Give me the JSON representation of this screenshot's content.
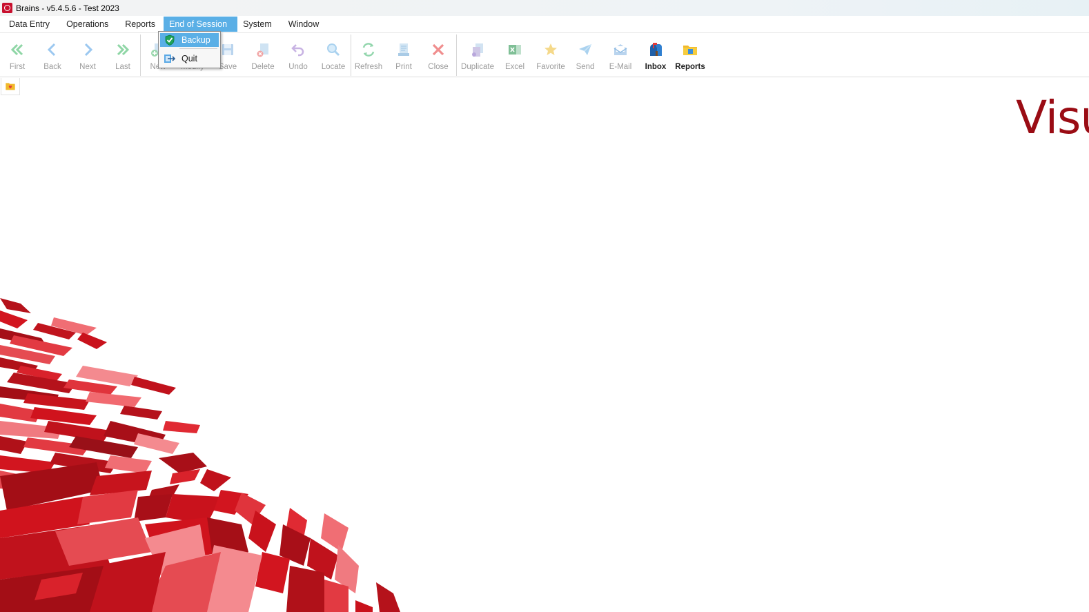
{
  "window": {
    "title": "Brains - v5.4.5.6 - Test 2023"
  },
  "menubar": {
    "items": [
      "Data Entry",
      "Operations",
      "Reports",
      "End of Session",
      "System",
      "Window"
    ],
    "active": "End of Session"
  },
  "dropdown": {
    "items": [
      {
        "label": "Backup",
        "icon": "backup-check-icon",
        "highlighted": true
      },
      {
        "label": "Quit",
        "icon": "quit-arrow-icon",
        "highlighted": false
      }
    ]
  },
  "toolbar": {
    "buttons": [
      {
        "label": "First",
        "icon": "double-chevron-left-icon",
        "enabled": false
      },
      {
        "label": "Back",
        "icon": "chevron-left-icon",
        "enabled": false
      },
      {
        "label": "Next",
        "icon": "chevron-right-icon",
        "enabled": false
      },
      {
        "label": "Last",
        "icon": "double-chevron-right-icon",
        "enabled": false
      },
      {
        "label": "New",
        "icon": "new-icon",
        "enabled": false
      },
      {
        "label": "Modify",
        "icon": "modify-icon",
        "enabled": false
      },
      {
        "label": "Save",
        "icon": "save-icon",
        "enabled": false
      },
      {
        "label": "Delete",
        "icon": "delete-icon",
        "enabled": false
      },
      {
        "label": "Undo",
        "icon": "undo-icon",
        "enabled": false
      },
      {
        "label": "Locate",
        "icon": "locate-icon",
        "enabled": false
      },
      {
        "label": "Refresh",
        "icon": "refresh-icon",
        "enabled": false
      },
      {
        "label": "Print",
        "icon": "print-icon",
        "enabled": false
      },
      {
        "label": "Close",
        "icon": "close-icon",
        "enabled": false
      },
      {
        "label": "Duplicate",
        "icon": "duplicate-icon",
        "enabled": false
      },
      {
        "label": "Excel",
        "icon": "excel-icon",
        "enabled": false
      },
      {
        "label": "Favorite",
        "icon": "favorite-star-icon",
        "enabled": false
      },
      {
        "label": "Send",
        "icon": "send-plane-icon",
        "enabled": false
      },
      {
        "label": "E-Mail",
        "icon": "email-icon",
        "enabled": false
      },
      {
        "label": "Inbox",
        "icon": "inbox-mailbox-icon",
        "enabled": true
      },
      {
        "label": "Reports",
        "icon": "reports-folder-icon",
        "enabled": true
      }
    ]
  },
  "brand": {
    "text": "Visu"
  },
  "colors": {
    "accent": "#5aafe6",
    "brand_red": "#9a0c14",
    "decor_red": "#c8101e",
    "disabled_text": "#9a9a9a"
  }
}
